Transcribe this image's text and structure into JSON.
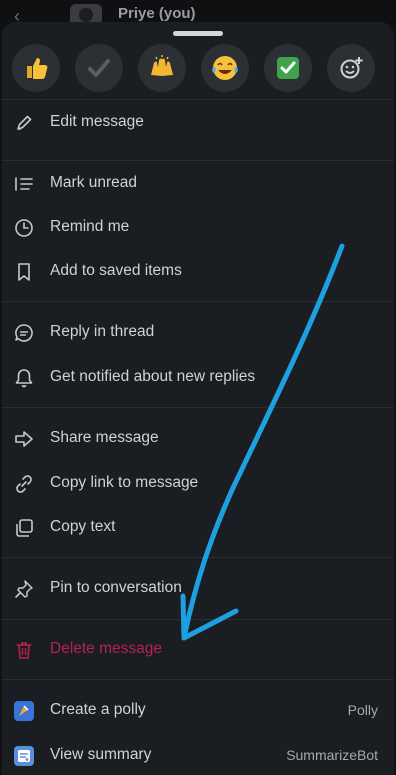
{
  "background": {
    "chat_user_name": "Priye (you)"
  },
  "reactions": [
    {
      "icon": "thumbs-up-emoji"
    },
    {
      "icon": "check-mark-emoji"
    },
    {
      "icon": "raised-hands-emoji"
    },
    {
      "icon": "tears-of-joy-emoji"
    },
    {
      "icon": "check-box-emoji"
    },
    {
      "icon": "add-reaction-icon"
    }
  ],
  "menu": {
    "edit": "Edit message",
    "mark_unread": "Mark unread",
    "remind": "Remind me",
    "save": "Add to saved items",
    "reply_thread": "Reply in thread",
    "notify_replies": "Get notified about new replies",
    "share": "Share message",
    "copy_link": "Copy link to message",
    "copy_text": "Copy text",
    "pin": "Pin to conversation",
    "delete": "Delete message",
    "create_polly": "Create a polly",
    "create_polly_app": "Polly",
    "view_summary": "View summary",
    "view_summary_app": "SummarizeBot"
  },
  "colors": {
    "sheet_bg": "#1a1d21",
    "text": "#d1d2d3",
    "danger": "#b8224f",
    "annotation_arrow": "#1e9fe0"
  }
}
